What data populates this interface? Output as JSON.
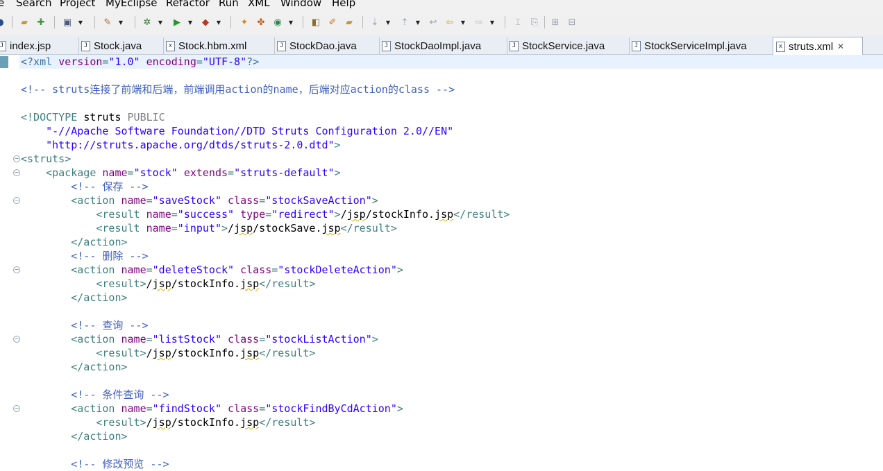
{
  "menu": [
    "e",
    "Search",
    "Project",
    "MyEclipse",
    "Refactor",
    "Run",
    "XML",
    "Window",
    "Help"
  ],
  "tabs": [
    {
      "label": "index.jsp",
      "icon": "jsp-file-icon",
      "glyph": "J"
    },
    {
      "label": "Stock.java",
      "icon": "java-file-icon",
      "glyph": "J"
    },
    {
      "label": "Stock.hbm.xml",
      "icon": "hbm-xml-file-icon",
      "glyph": "x"
    },
    {
      "label": "StockDao.java",
      "icon": "java-file-icon",
      "glyph": "J"
    },
    {
      "label": "StockDaoImpl.java",
      "icon": "java-file-icon",
      "glyph": "J"
    },
    {
      "label": "StockService.java",
      "icon": "java-file-icon",
      "glyph": "J"
    },
    {
      "label": "StockServiceImpl.java",
      "icon": "java-file-icon",
      "glyph": "J"
    },
    {
      "label": "struts.xml",
      "icon": "xml-file-icon",
      "glyph": "x",
      "active": true
    }
  ],
  "tab_close_glyph": "✕",
  "editor": {
    "lines": [
      {
        "tokens": [
          [
            "decl",
            "<?xml "
          ],
          [
            "attr",
            "version"
          ],
          [
            "tag",
            "="
          ],
          [
            "val",
            "\"1.0\""
          ],
          [
            "tag",
            " "
          ],
          [
            "attr",
            "encoding"
          ],
          [
            "tag",
            "="
          ],
          [
            "val",
            "\"UTF-8\""
          ],
          [
            "decl",
            "?>"
          ]
        ]
      },
      {
        "tokens": []
      },
      {
        "tokens": [
          [
            "comment",
            "<!-- struts连接了前端和后端，前端调用action的name，后端对应action的class -->"
          ]
        ]
      },
      {
        "tokens": []
      },
      {
        "tokens": [
          [
            "doctype",
            "<!DOCTYPE "
          ],
          [
            "dtkw",
            "struts "
          ],
          [
            "dtpub",
            "PUBLIC"
          ]
        ]
      },
      {
        "tokens": [
          [
            "text",
            "    "
          ],
          [
            "val",
            "\"-//Apache Software Foundation//DTD Struts Configuration 2.0//EN\""
          ]
        ]
      },
      {
        "tokens": [
          [
            "text",
            "    "
          ],
          [
            "val",
            "\"http://struts.apache.org/dtds/struts-2.0.dtd\""
          ],
          [
            "doctype",
            ">"
          ]
        ]
      },
      {
        "tokens": [
          [
            "tag",
            "<struts>"
          ]
        ],
        "fold": false
      },
      {
        "tokens": [
          [
            "text",
            "    "
          ],
          [
            "tag",
            "<package "
          ],
          [
            "attr",
            "name"
          ],
          [
            "tag",
            "="
          ],
          [
            "val",
            "\"stock\""
          ],
          [
            "tag",
            " "
          ],
          [
            "attr",
            "extends"
          ],
          [
            "tag",
            "="
          ],
          [
            "val",
            "\"struts-default\""
          ],
          [
            "tag",
            ">"
          ]
        ],
        "fold": true
      },
      {
        "tokens": [
          [
            "text",
            "        "
          ],
          [
            "comment",
            "<!-- 保存 -->"
          ]
        ]
      },
      {
        "tokens": [
          [
            "text",
            "        "
          ],
          [
            "tag",
            "<action "
          ],
          [
            "attr",
            "name"
          ],
          [
            "tag",
            "="
          ],
          [
            "val",
            "\"saveStock\""
          ],
          [
            "tag",
            " "
          ],
          [
            "attr",
            "class"
          ],
          [
            "tag",
            "="
          ],
          [
            "val",
            "\"stockSaveAction\""
          ],
          [
            "tag",
            ">"
          ]
        ],
        "fold": true
      },
      {
        "tokens": [
          [
            "text",
            "            "
          ],
          [
            "tag",
            "<result "
          ],
          [
            "attr",
            "name"
          ],
          [
            "tag",
            "="
          ],
          [
            "val",
            "\"success\""
          ],
          [
            "tag",
            " "
          ],
          [
            "attr",
            "type"
          ],
          [
            "tag",
            "="
          ],
          [
            "val",
            "\"redirect\""
          ],
          [
            "tag",
            ">"
          ],
          [
            "text",
            "/"
          ],
          [
            "sq",
            "jsp"
          ],
          [
            "text",
            "/stockInfo."
          ],
          [
            "sq",
            "jsp"
          ],
          [
            "tag",
            "</result>"
          ]
        ]
      },
      {
        "tokens": [
          [
            "text",
            "            "
          ],
          [
            "tag",
            "<result "
          ],
          [
            "attr",
            "name"
          ],
          [
            "tag",
            "="
          ],
          [
            "val",
            "\"input\""
          ],
          [
            "tag",
            ">"
          ],
          [
            "text",
            "/"
          ],
          [
            "sq",
            "jsp"
          ],
          [
            "text",
            "/stockSave."
          ],
          [
            "sq",
            "jsp"
          ],
          [
            "tag",
            "</result>"
          ]
        ]
      },
      {
        "tokens": [
          [
            "text",
            "        "
          ],
          [
            "tag",
            "</action>"
          ]
        ]
      },
      {
        "tokens": [
          [
            "text",
            "        "
          ],
          [
            "comment",
            "<!-- 删除 -->"
          ]
        ]
      },
      {
        "tokens": [
          [
            "text",
            "        "
          ],
          [
            "tag",
            "<action "
          ],
          [
            "attr",
            "name"
          ],
          [
            "tag",
            "="
          ],
          [
            "val",
            "\"deleteStock\""
          ],
          [
            "tag",
            " "
          ],
          [
            "attr",
            "class"
          ],
          [
            "tag",
            "="
          ],
          [
            "val",
            "\"stockDeleteAction\""
          ],
          [
            "tag",
            ">"
          ]
        ],
        "fold": true
      },
      {
        "tokens": [
          [
            "text",
            "            "
          ],
          [
            "tag",
            "<result>"
          ],
          [
            "text",
            "/"
          ],
          [
            "sq",
            "jsp"
          ],
          [
            "text",
            "/stockInfo."
          ],
          [
            "sq",
            "jsp"
          ],
          [
            "tag",
            "</result>"
          ]
        ]
      },
      {
        "tokens": [
          [
            "text",
            "        "
          ],
          [
            "tag",
            "</action>"
          ]
        ]
      },
      {
        "tokens": []
      },
      {
        "tokens": [
          [
            "text",
            "        "
          ],
          [
            "comment",
            "<!-- 查询 -->"
          ]
        ]
      },
      {
        "tokens": [
          [
            "text",
            "        "
          ],
          [
            "tag",
            "<action "
          ],
          [
            "attr",
            "name"
          ],
          [
            "tag",
            "="
          ],
          [
            "val",
            "\"listStock\""
          ],
          [
            "tag",
            " "
          ],
          [
            "attr",
            "class"
          ],
          [
            "tag",
            "="
          ],
          [
            "val",
            "\"stockListAction\""
          ],
          [
            "tag",
            ">"
          ]
        ],
        "fold": true
      },
      {
        "tokens": [
          [
            "text",
            "            "
          ],
          [
            "tag",
            "<result>"
          ],
          [
            "text",
            "/"
          ],
          [
            "sq",
            "jsp"
          ],
          [
            "text",
            "/stockInfo."
          ],
          [
            "sq",
            "jsp"
          ],
          [
            "tag",
            "</result>"
          ]
        ]
      },
      {
        "tokens": [
          [
            "text",
            "        "
          ],
          [
            "tag",
            "</action>"
          ]
        ]
      },
      {
        "tokens": []
      },
      {
        "tokens": [
          [
            "text",
            "        "
          ],
          [
            "comment",
            "<!-- 条件查询 -->"
          ]
        ]
      },
      {
        "tokens": [
          [
            "text",
            "        "
          ],
          [
            "tag",
            "<action "
          ],
          [
            "attr",
            "name"
          ],
          [
            "tag",
            "="
          ],
          [
            "val",
            "\"findStock\""
          ],
          [
            "tag",
            " "
          ],
          [
            "attr",
            "class"
          ],
          [
            "tag",
            "="
          ],
          [
            "val",
            "\"stockFindByCdAction\""
          ],
          [
            "tag",
            ">"
          ]
        ],
        "fold": true
      },
      {
        "tokens": [
          [
            "text",
            "            "
          ],
          [
            "tag",
            "<result>"
          ],
          [
            "text",
            "/"
          ],
          [
            "sq",
            "jsp"
          ],
          [
            "text",
            "/stockInfo."
          ],
          [
            "sq",
            "jsp"
          ],
          [
            "tag",
            "</result>"
          ]
        ]
      },
      {
        "tokens": [
          [
            "text",
            "        "
          ],
          [
            "tag",
            "</action>"
          ]
        ]
      },
      {
        "tokens": []
      },
      {
        "tokens": [
          [
            "text",
            "        "
          ],
          [
            "comment",
            "<!-- 修改预览 -->"
          ]
        ]
      }
    ]
  },
  "colors": {
    "decl": "#3b6fa1",
    "tag": "#3f7f7f",
    "attr": "#7f007f",
    "value": "#2a00ff",
    "comment": "#3f5fbf",
    "current_line": "#e8f2fe"
  }
}
